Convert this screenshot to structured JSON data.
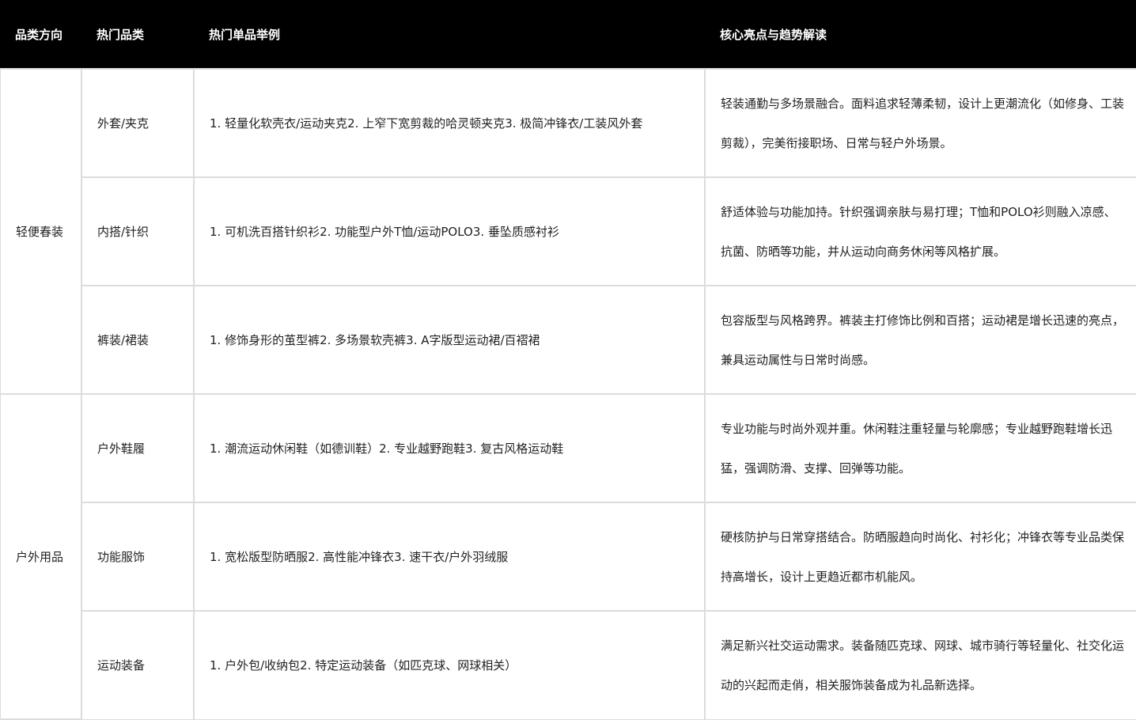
{
  "table": {
    "headers": [
      "品类方向",
      "热门品类",
      "热门单品举例",
      "核心亮点与趋势解读"
    ],
    "groups": [
      {
        "direction": "轻便春装",
        "rows": [
          {
            "category": "外套/夹克",
            "examples": "1. 轻量化软壳衣/运动夹克2. 上窄下宽剪裁的哈灵顿夹克3. 极简冲锋衣/工装风外套",
            "insight": "轻装通勤与多场景融合。面料追求轻薄柔韧，设计上更潮流化（如修身、工装剪裁），完美衔接职场、日常与轻户外场景。"
          },
          {
            "category": "内搭/针织",
            "examples": "1. 可机洗百搭针织衫2. 功能型户外T恤/运动POLO3. 垂坠质感衬衫",
            "insight": "舒适体验与功能加持。针织强调亲肤与易打理；T恤和POLO衫则融入凉感、抗菌、防晒等功能，并从运动向商务休闲等风格扩展。"
          },
          {
            "category": "裤装/裙装",
            "examples": "1. 修饰身形的茧型裤2. 多场景软壳裤3. A字版型运动裙/百褶裙",
            "insight": "包容版型与风格跨界。裤装主打修饰比例和百搭；运动裙是增长迅速的亮点，兼具运动属性与日常时尚感。"
          }
        ]
      },
      {
        "direction": "户外用品",
        "rows": [
          {
            "category": "户外鞋履",
            "examples": "1. 潮流运动休闲鞋（如德训鞋）2. 专业越野跑鞋3. 复古风格运动鞋",
            "insight": "专业功能与时尚外观并重。休闲鞋注重轻量与轮廓感；专业越野跑鞋增长迅猛，强调防滑、支撑、回弹等功能。"
          },
          {
            "category": "功能服饰",
            "examples": "1. 宽松版型防晒服2. 高性能冲锋衣3. 速干衣/户外羽绒服",
            "insight": "硬核防护与日常穿搭结合。防晒服趋向时尚化、衬衫化；冲锋衣等专业品类保持高增长，设计上更趋近都市机能风。"
          },
          {
            "category": "运动装备",
            "examples": "1. 户外包/收纳包2. 特定运动装备（如匹克球、网球相关）",
            "insight": "满足新兴社交运动需求。装备随匹克球、网球、城市骑行等轻量化、社交化运动的兴起而走俏，相关服饰装备成为礼品新选择。"
          }
        ]
      }
    ]
  }
}
